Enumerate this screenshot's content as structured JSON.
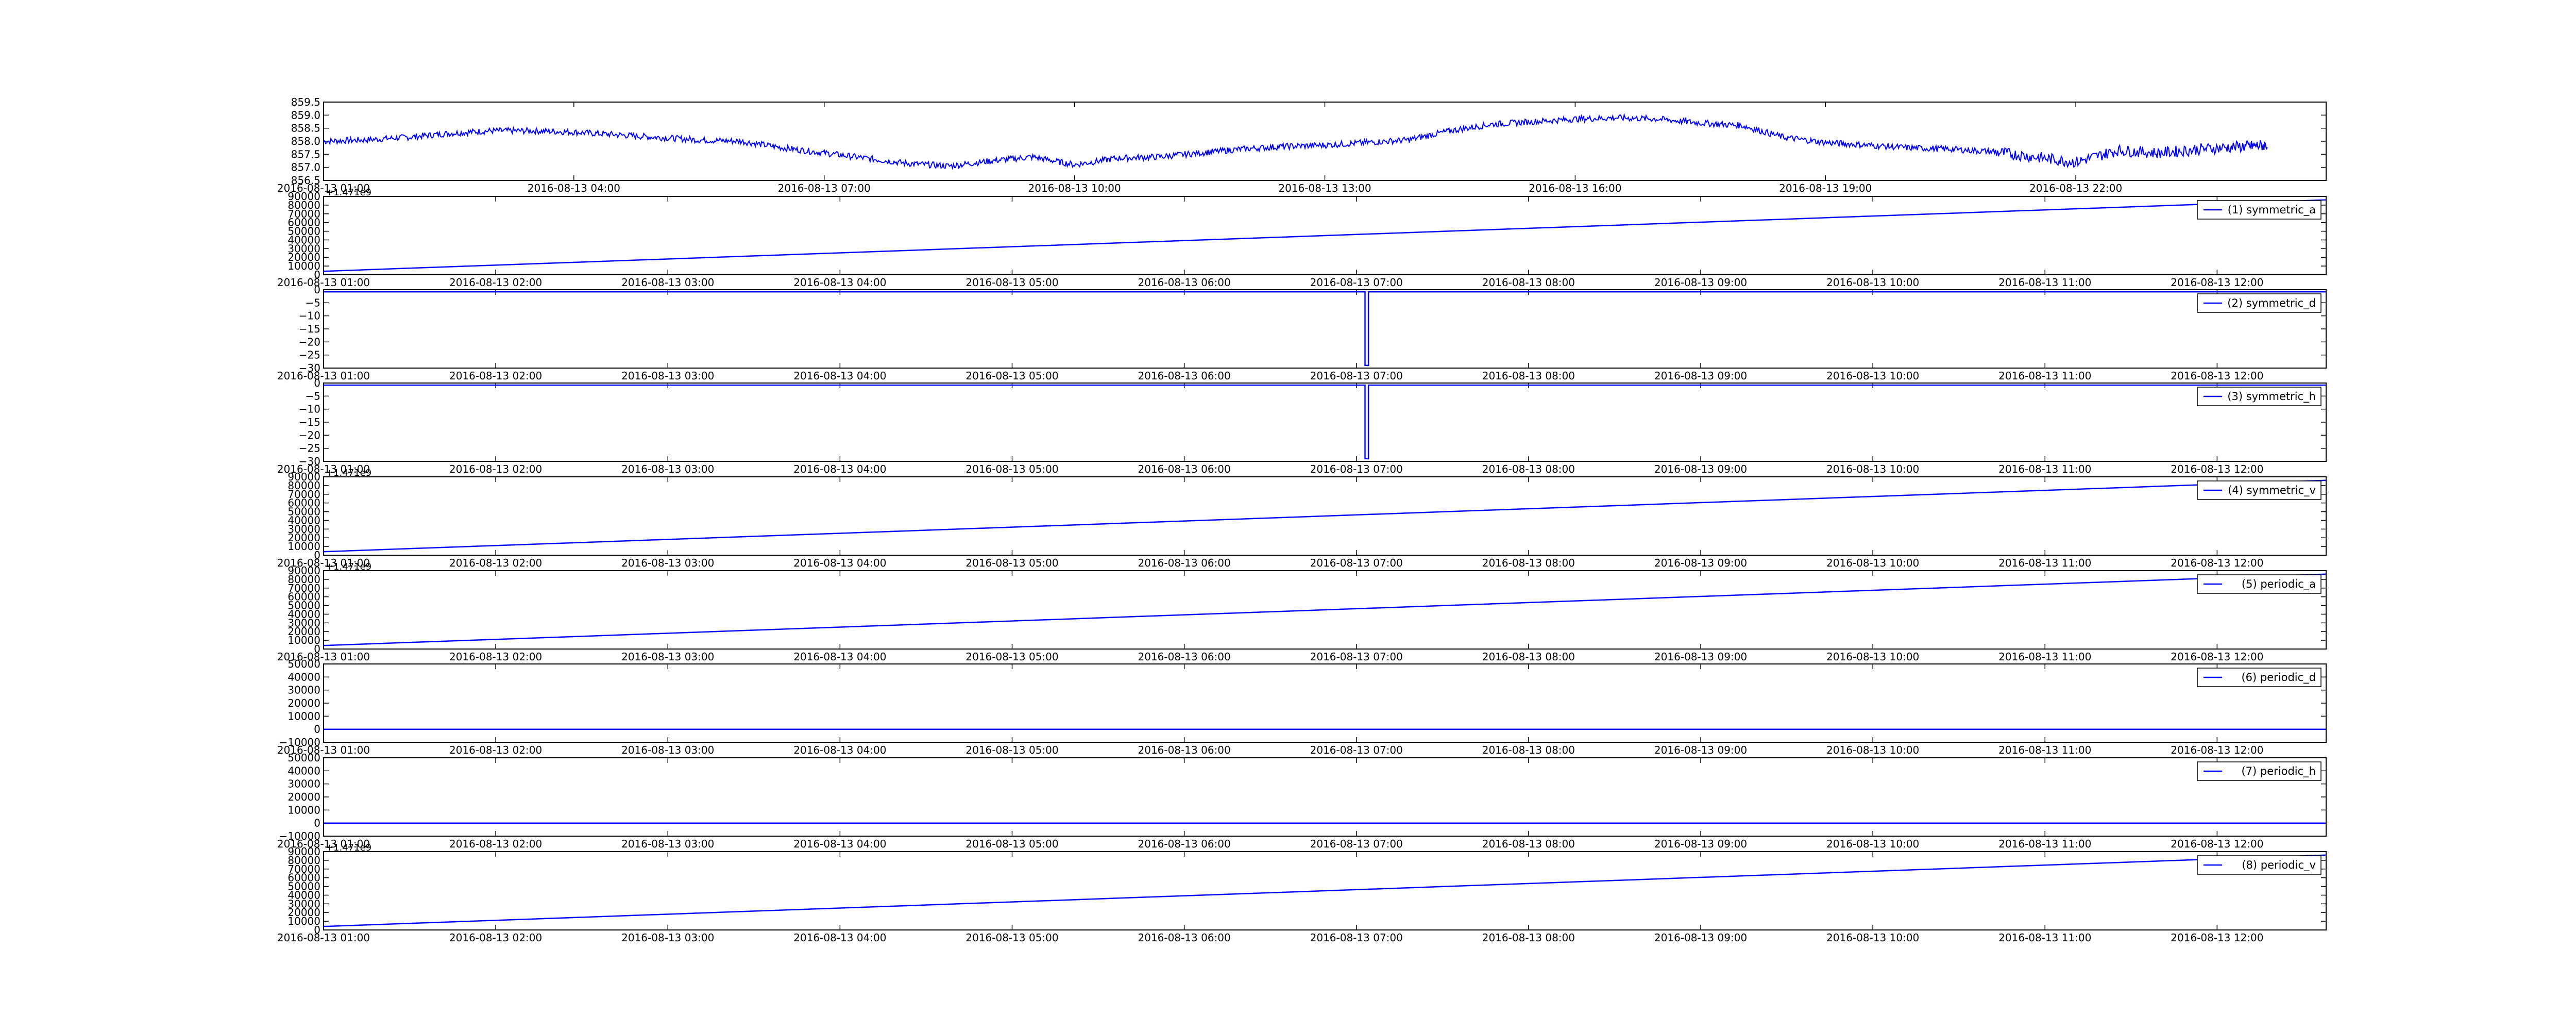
{
  "figure": {
    "line_color": "#0000ff",
    "axes_color": "#000000",
    "background": "#ffffff"
  },
  "chart_data": [
    {
      "type": "line",
      "title": "",
      "xlabel": "",
      "ylabel": "",
      "ylim": [
        856.5,
        859.5
      ],
      "yticks": [
        856.5,
        857.0,
        857.5,
        858.0,
        858.5,
        859.0,
        859.5
      ],
      "ytick_labels": [
        "856.5",
        "857.0",
        "857.5",
        "858.0",
        "858.5",
        "859.0",
        "859.5"
      ],
      "xlim": [
        "2016-08-13 01:00",
        "2016-08-14 01:00"
      ],
      "xtick_labels": [
        "2016-08-13 01:00",
        "2016-08-13 04:00",
        "2016-08-13 07:00",
        "2016-08-13 10:00",
        "2016-08-13 13:00",
        "2016-08-13 16:00",
        "2016-08-13 19:00",
        "2016-08-13 22:00"
      ],
      "xtick_hours": [
        0,
        3,
        6,
        9,
        12,
        15,
        18,
        21
      ],
      "grid": false,
      "legend": null,
      "noisy": true,
      "series": [
        {
          "x_hours": [
            0,
            0.5,
            1,
            1.5,
            2,
            2.5,
            3,
            3.5,
            4,
            4.5,
            5,
            5.5,
            6,
            6.5,
            7,
            7.5,
            8,
            8.5,
            9,
            9.5,
            10,
            10.5,
            11,
            11.5,
            12,
            12.5,
            13,
            13.5,
            14,
            14.5,
            15,
            15.5,
            16,
            16.5,
            17,
            17.5,
            18,
            18.5,
            19,
            19.5,
            20,
            20.5,
            21,
            21.5,
            22,
            22.5,
            23,
            23.3
          ],
          "values": [
            858.0,
            858.05,
            858.15,
            858.3,
            858.4,
            858.4,
            858.35,
            858.25,
            858.15,
            858.05,
            858.0,
            857.75,
            857.55,
            857.35,
            857.15,
            857.05,
            857.25,
            857.4,
            857.1,
            857.35,
            857.4,
            857.55,
            857.7,
            857.8,
            857.85,
            857.95,
            858.05,
            858.4,
            858.65,
            858.75,
            858.85,
            858.9,
            858.85,
            858.7,
            858.6,
            858.15,
            857.95,
            857.85,
            857.75,
            857.7,
            857.6,
            857.4,
            857.2,
            857.65,
            857.55,
            857.7,
            857.8,
            857.85
          ]
        }
      ]
    },
    {
      "type": "line",
      "offset_label": "+1.471e9",
      "ylim": [
        0,
        90000
      ],
      "yticks": [
        0,
        10000,
        20000,
        30000,
        40000,
        50000,
        60000,
        70000,
        80000,
        90000
      ],
      "ytick_labels": [
        "0",
        "10000",
        "20000",
        "30000",
        "40000",
        "50000",
        "60000",
        "70000",
        "80000",
        "90000"
      ],
      "xlim": [
        "2016-08-13 01:00",
        "2016-08-13 12:38"
      ],
      "xtick_labels": [
        "2016-08-13 01:00",
        "2016-08-13 02:00",
        "2016-08-13 03:00",
        "2016-08-13 04:00",
        "2016-08-13 05:00",
        "2016-08-13 06:00",
        "2016-08-13 07:00",
        "2016-08-13 08:00",
        "2016-08-13 09:00",
        "2016-08-13 10:00",
        "2016-08-13 11:00",
        "2016-08-13 12:00"
      ],
      "xtick_hours": [
        0,
        1,
        2,
        3,
        4,
        5,
        6,
        7,
        8,
        9,
        10,
        11
      ],
      "grid": false,
      "legend": "top-right",
      "series": [
        {
          "name": "(1) symmetric_a",
          "x_hours": [
            0,
            11.63
          ],
          "values": [
            4000,
            86000
          ]
        }
      ]
    },
    {
      "type": "line",
      "ylim": [
        -30,
        0
      ],
      "yticks": [
        -30,
        -25,
        -20,
        -15,
        -10,
        -5,
        0
      ],
      "ytick_labels": [
        "−30",
        "−25",
        "−20",
        "−15",
        "−10",
        "−5",
        "0"
      ],
      "xlim": [
        "2016-08-13 01:00",
        "2016-08-13 12:38"
      ],
      "xtick_labels": [
        "2016-08-13 01:00",
        "2016-08-13 02:00",
        "2016-08-13 03:00",
        "2016-08-13 04:00",
        "2016-08-13 05:00",
        "2016-08-13 06:00",
        "2016-08-13 07:00",
        "2016-08-13 08:00",
        "2016-08-13 09:00",
        "2016-08-13 10:00",
        "2016-08-13 11:00",
        "2016-08-13 12:00"
      ],
      "xtick_hours": [
        0,
        1,
        2,
        3,
        4,
        5,
        6,
        7,
        8,
        9,
        10,
        11
      ],
      "grid": false,
      "legend": "top-right",
      "series": [
        {
          "name": "(2) symmetric_d",
          "x_hours": [
            0,
            6.05,
            6.05,
            6.07,
            6.07,
            11.63
          ],
          "values": [
            -0.8,
            -0.8,
            -29,
            -29,
            -0.8,
            -0.8
          ]
        }
      ]
    },
    {
      "type": "line",
      "ylim": [
        -30,
        0
      ],
      "yticks": [
        -30,
        -25,
        -20,
        -15,
        -10,
        -5,
        0
      ],
      "ytick_labels": [
        "−30",
        "−25",
        "−20",
        "−15",
        "−10",
        "−5",
        "0"
      ],
      "xlim": [
        "2016-08-13 01:00",
        "2016-08-13 12:38"
      ],
      "xtick_labels": [
        "2016-08-13 01:00",
        "2016-08-13 02:00",
        "2016-08-13 03:00",
        "2016-08-13 04:00",
        "2016-08-13 05:00",
        "2016-08-13 06:00",
        "2016-08-13 07:00",
        "2016-08-13 08:00",
        "2016-08-13 09:00",
        "2016-08-13 10:00",
        "2016-08-13 11:00",
        "2016-08-13 12:00"
      ],
      "xtick_hours": [
        0,
        1,
        2,
        3,
        4,
        5,
        6,
        7,
        8,
        9,
        10,
        11
      ],
      "grid": false,
      "legend": "top-right",
      "series": [
        {
          "name": "(3) symmetric_h",
          "x_hours": [
            0,
            6.05,
            6.05,
            6.07,
            6.07,
            11.63
          ],
          "values": [
            -0.8,
            -0.8,
            -29,
            -29,
            -0.8,
            -0.8
          ]
        }
      ]
    },
    {
      "type": "line",
      "offset_label": "+1.471e9",
      "ylim": [
        0,
        90000
      ],
      "yticks": [
        0,
        10000,
        20000,
        30000,
        40000,
        50000,
        60000,
        70000,
        80000,
        90000
      ],
      "ytick_labels": [
        "0",
        "10000",
        "20000",
        "30000",
        "40000",
        "50000",
        "60000",
        "70000",
        "80000",
        "90000"
      ],
      "xlim": [
        "2016-08-13 01:00",
        "2016-08-13 12:38"
      ],
      "xtick_labels": [
        "2016-08-13 01:00",
        "2016-08-13 02:00",
        "2016-08-13 03:00",
        "2016-08-13 04:00",
        "2016-08-13 05:00",
        "2016-08-13 06:00",
        "2016-08-13 07:00",
        "2016-08-13 08:00",
        "2016-08-13 09:00",
        "2016-08-13 10:00",
        "2016-08-13 11:00",
        "2016-08-13 12:00"
      ],
      "xtick_hours": [
        0,
        1,
        2,
        3,
        4,
        5,
        6,
        7,
        8,
        9,
        10,
        11
      ],
      "grid": false,
      "legend": "top-right",
      "series": [
        {
          "name": "(4) symmetric_v",
          "x_hours": [
            0,
            11.63
          ],
          "values": [
            4000,
            86000
          ]
        }
      ]
    },
    {
      "type": "line",
      "offset_label": "+1.471e9",
      "ylim": [
        0,
        90000
      ],
      "yticks": [
        0,
        10000,
        20000,
        30000,
        40000,
        50000,
        60000,
        70000,
        80000,
        90000
      ],
      "ytick_labels": [
        "0",
        "10000",
        "20000",
        "30000",
        "40000",
        "50000",
        "60000",
        "70000",
        "80000",
        "90000"
      ],
      "xlim": [
        "2016-08-13 01:00",
        "2016-08-13 12:38"
      ],
      "xtick_labels": [
        "2016-08-13 01:00",
        "2016-08-13 02:00",
        "2016-08-13 03:00",
        "2016-08-13 04:00",
        "2016-08-13 05:00",
        "2016-08-13 06:00",
        "2016-08-13 07:00",
        "2016-08-13 08:00",
        "2016-08-13 09:00",
        "2016-08-13 10:00",
        "2016-08-13 11:00",
        "2016-08-13 12:00"
      ],
      "xtick_hours": [
        0,
        1,
        2,
        3,
        4,
        5,
        6,
        7,
        8,
        9,
        10,
        11
      ],
      "grid": false,
      "legend": "top-right",
      "series": [
        {
          "name": "(5) periodic_a",
          "x_hours": [
            0,
            11.63
          ],
          "values": [
            4000,
            86000
          ]
        }
      ]
    },
    {
      "type": "line",
      "ylim": [
        -10000,
        50000
      ],
      "yticks": [
        -10000,
        0,
        10000,
        20000,
        30000,
        40000,
        50000
      ],
      "ytick_labels": [
        "−10000",
        "0",
        "10000",
        "20000",
        "30000",
        "40000",
        "50000"
      ],
      "xlim": [
        "2016-08-13 01:00",
        "2016-08-13 12:38"
      ],
      "xtick_labels": [
        "2016-08-13 01:00",
        "2016-08-13 02:00",
        "2016-08-13 03:00",
        "2016-08-13 04:00",
        "2016-08-13 05:00",
        "2016-08-13 06:00",
        "2016-08-13 07:00",
        "2016-08-13 08:00",
        "2016-08-13 09:00",
        "2016-08-13 10:00",
        "2016-08-13 11:00",
        "2016-08-13 12:00"
      ],
      "xtick_hours": [
        0,
        1,
        2,
        3,
        4,
        5,
        6,
        7,
        8,
        9,
        10,
        11
      ],
      "grid": false,
      "legend": "top-right",
      "series": [
        {
          "name": "(6) periodic_d",
          "x_hours": [
            0,
            11.63
          ],
          "values": [
            0,
            0
          ]
        }
      ]
    },
    {
      "type": "line",
      "ylim": [
        -10000,
        50000
      ],
      "yticks": [
        -10000,
        0,
        10000,
        20000,
        30000,
        40000,
        50000
      ],
      "ytick_labels": [
        "−10000",
        "0",
        "10000",
        "20000",
        "30000",
        "40000",
        "50000"
      ],
      "xlim": [
        "2016-08-13 01:00",
        "2016-08-13 12:38"
      ],
      "xtick_labels": [
        "2016-08-13 01:00",
        "2016-08-13 02:00",
        "2016-08-13 03:00",
        "2016-08-13 04:00",
        "2016-08-13 05:00",
        "2016-08-13 06:00",
        "2016-08-13 07:00",
        "2016-08-13 08:00",
        "2016-08-13 09:00",
        "2016-08-13 10:00",
        "2016-08-13 11:00",
        "2016-08-13 12:00"
      ],
      "xtick_hours": [
        0,
        1,
        2,
        3,
        4,
        5,
        6,
        7,
        8,
        9,
        10,
        11
      ],
      "grid": false,
      "legend": "top-right",
      "series": [
        {
          "name": "(7) periodic_h",
          "x_hours": [
            0,
            11.63
          ],
          "values": [
            0,
            0
          ]
        }
      ]
    },
    {
      "type": "line",
      "offset_label": "+1.471e9",
      "ylim": [
        0,
        90000
      ],
      "yticks": [
        0,
        10000,
        20000,
        30000,
        40000,
        50000,
        60000,
        70000,
        80000,
        90000
      ],
      "ytick_labels": [
        "0",
        "10000",
        "20000",
        "30000",
        "40000",
        "50000",
        "60000",
        "70000",
        "80000",
        "90000"
      ],
      "xlim": [
        "2016-08-13 01:00",
        "2016-08-13 12:38"
      ],
      "xtick_labels": [
        "2016-08-13 01:00",
        "2016-08-13 02:00",
        "2016-08-13 03:00",
        "2016-08-13 04:00",
        "2016-08-13 05:00",
        "2016-08-13 06:00",
        "2016-08-13 07:00",
        "2016-08-13 08:00",
        "2016-08-13 09:00",
        "2016-08-13 10:00",
        "2016-08-13 11:00",
        "2016-08-13 12:00"
      ],
      "xtick_hours": [
        0,
        1,
        2,
        3,
        4,
        5,
        6,
        7,
        8,
        9,
        10,
        11
      ],
      "grid": false,
      "legend": "top-right",
      "series": [
        {
          "name": "(8) periodic_v",
          "x_hours": [
            0,
            11.63
          ],
          "values": [
            4000,
            86000
          ]
        }
      ]
    }
  ]
}
